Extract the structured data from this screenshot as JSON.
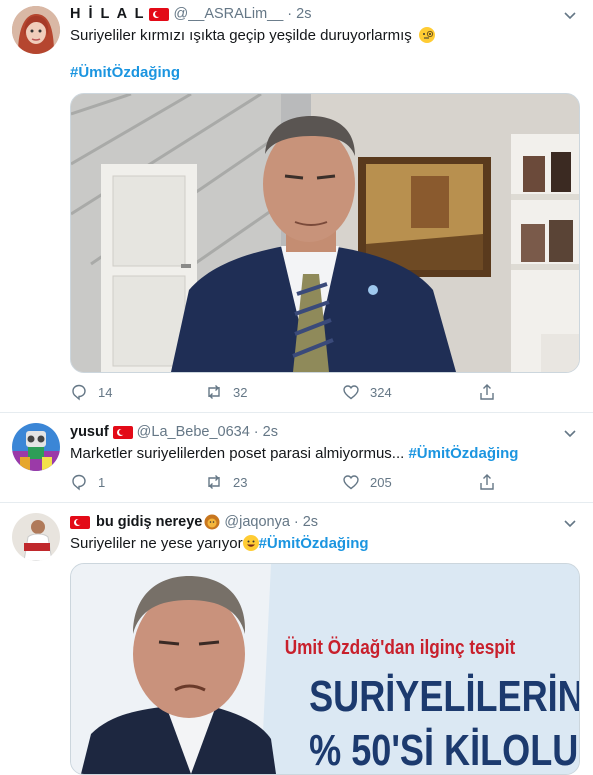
{
  "tweets": [
    {
      "display_name": "H İ L A L",
      "handle": "@__ASRALim__",
      "dot": "·",
      "time": "2s",
      "text": "Suriyeliler kırmızı ışıkta geçip yeşilde duruyorlarmış",
      "hashtag": "#ÜmitÖzdağing",
      "replies": "14",
      "retweets": "32",
      "likes": "324"
    },
    {
      "display_name": "yusuf",
      "handle": "@La_Bebe_0634",
      "dot": "·",
      "time": "2s",
      "text": "Marketler suriyelilerden poset parasi almiyormus...",
      "hashtag": "#ÜmitÖzdağing",
      "replies": "1",
      "retweets": "23",
      "likes": "205"
    },
    {
      "display_name": "bu gidiş nereye",
      "handle": "@jaqonya",
      "dot": "·",
      "time": "2s",
      "text": "Suriyeliler ne yese yarıyor",
      "hashtag": "#ÜmitÖzdağing",
      "image_headline": "Ümit Özdağ'dan ilginç tespit",
      "image_big_1": "SURİYELİLERİN",
      "image_big_2": "% 50'Sİ KİLOLU"
    }
  ],
  "colors": {
    "hashtag": "#1b95e0",
    "secondary_text": "#657786",
    "divider": "#e6ecf0",
    "image_headline_red": "#c8202c",
    "image_big_navy": "#1c3a6e"
  },
  "icons": [
    "reply-icon",
    "retweet-icon",
    "like-icon",
    "share-icon",
    "caret-down-icon",
    "turkish-flag-icon"
  ]
}
